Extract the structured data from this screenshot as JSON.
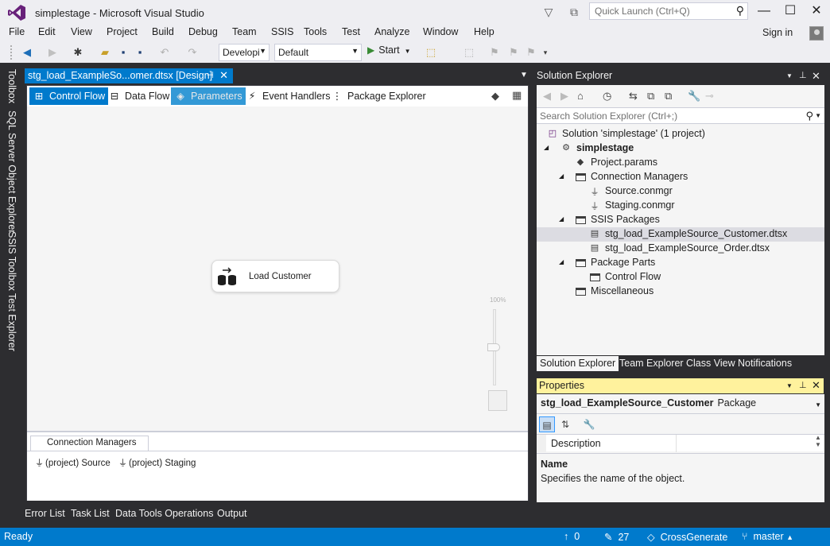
{
  "window": {
    "title": "simplestage - Microsoft Visual Studio",
    "quick_launch_placeholder": "Quick Launch (Ctrl+Q)",
    "sign_in": "Sign in"
  },
  "menu": [
    "File",
    "Edit",
    "View",
    "Project",
    "Build",
    "Debug",
    "Team",
    "SSIS",
    "Tools",
    "Test",
    "Analyze",
    "Window",
    "Help"
  ],
  "toolbar": {
    "config_value": "Developi",
    "platform_value": "Default",
    "start_label": "Start"
  },
  "left_rail": [
    "Toolbox",
    "SQL Server Object Explorer",
    "SSIS Toolbox",
    "Test Explorer"
  ],
  "document": {
    "tab_title": "stg_load_ExampleSo...omer.dtsx [Design]",
    "designer_tabs": [
      "Control Flow",
      "Data Flow",
      "Parameters",
      "Event Handlers",
      "Package Explorer"
    ],
    "task_label": "Load Customer",
    "zoom_label": "100%",
    "connection_managers_tab": "Connection Managers",
    "connections": [
      "(project) Source",
      "(project) Staging"
    ]
  },
  "solution_explorer": {
    "title": "Solution Explorer",
    "search_placeholder": "Search Solution Explorer (Ctrl+;)",
    "tree": [
      {
        "label": "Solution 'simplestage' (1 project)",
        "icon": "solution-icon"
      },
      {
        "label": "simplestage",
        "icon": "project-icon"
      },
      {
        "label": "Project.params",
        "icon": "params-icon"
      },
      {
        "label": "Connection Managers",
        "icon": "folder-icon"
      },
      {
        "label": "Source.conmgr",
        "icon": "connection-icon"
      },
      {
        "label": "Staging.conmgr",
        "icon": "connection-icon"
      },
      {
        "label": "SSIS Packages",
        "icon": "folder-icon"
      },
      {
        "label": "stg_load_ExampleSource_Customer.dtsx",
        "icon": "package-icon"
      },
      {
        "label": "stg_load_ExampleSource_Order.dtsx",
        "icon": "package-icon"
      },
      {
        "label": "Package Parts",
        "icon": "folder-icon"
      },
      {
        "label": "Control Flow",
        "icon": "folder-icon"
      },
      {
        "label": "Miscellaneous",
        "icon": "folder-icon"
      }
    ],
    "bottom_tabs": [
      "Solution Explorer",
      "Team Explorer",
      "Class View",
      "Notifications"
    ]
  },
  "properties": {
    "title": "Properties",
    "object_name": "stg_load_ExampleSource_Customer",
    "object_type": "Package",
    "row_name": "Description",
    "desc_title": "Name",
    "desc_text": "Specifies the name of the object."
  },
  "bottom_tabs": [
    "Error List",
    "Task List",
    "Data Tools Operations",
    "Output"
  ],
  "status": {
    "ready": "Ready",
    "up_count": "0",
    "edit_count": "27",
    "repo": "CrossGenerate",
    "branch": "master"
  },
  "colors": {
    "accent": "#007acc",
    "frame": "#2d2d30",
    "properties_header": "#fff29d"
  }
}
